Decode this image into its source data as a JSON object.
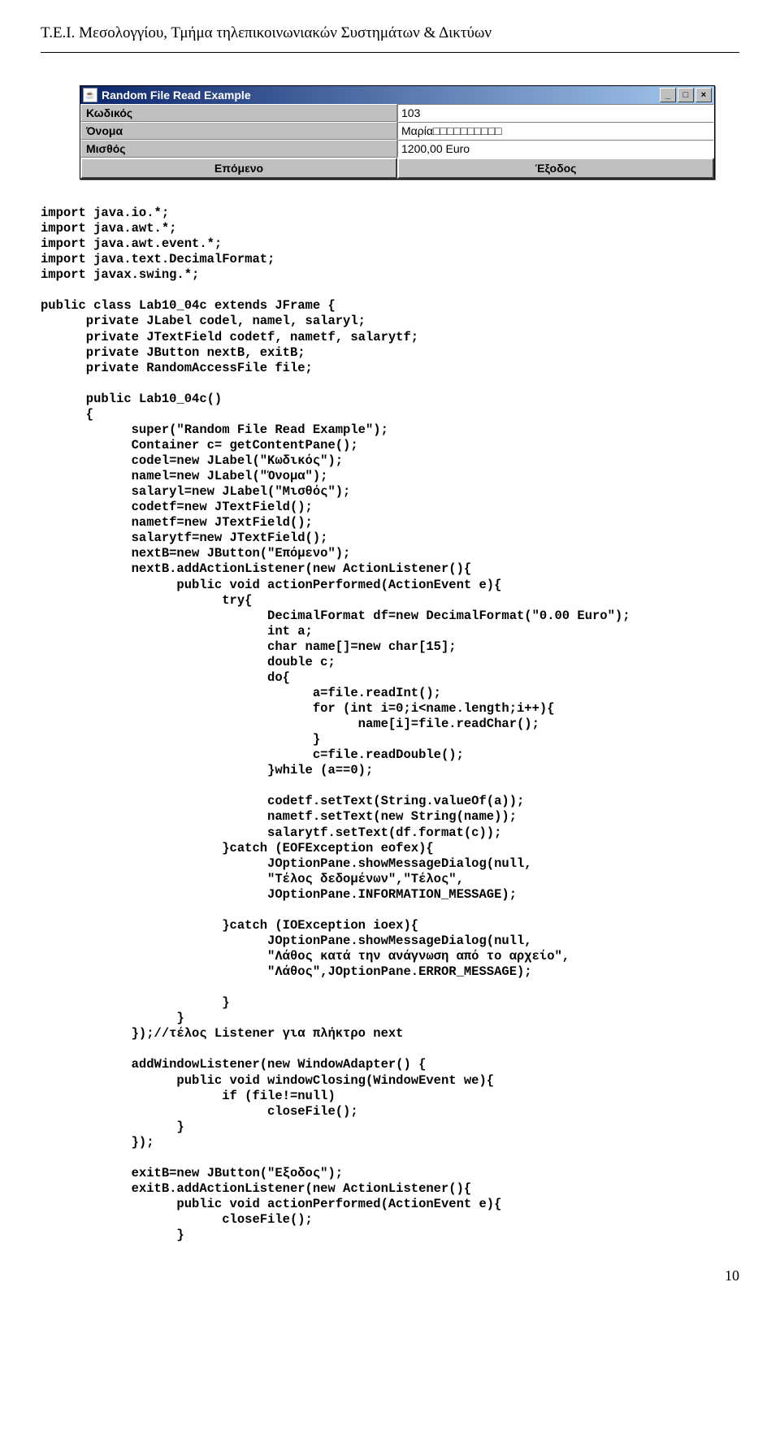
{
  "header": "Τ.Ε.Ι. Μεσολογγίου, Τμήμα τηλεπικοινωνιακών Συστημάτων & Δικτύων",
  "window": {
    "title": "Random File Read Example",
    "icon_alt": "☕",
    "min_symbol": "_",
    "max_symbol": "□",
    "close_symbol": "×",
    "rows": [
      {
        "label": "Κωδικός",
        "value": "103"
      },
      {
        "label": "Όνομα",
        "value": "Μαρία□□□□□□□□□□"
      },
      {
        "label": "Μισθός",
        "value": "1200,00 Euro"
      }
    ],
    "buttons": {
      "next": "Επόμενο",
      "exit": "Έξοδος"
    }
  },
  "code": "import java.io.*;\nimport java.awt.*;\nimport java.awt.event.*;\nimport java.text.DecimalFormat;\nimport javax.swing.*;\n\npublic class Lab10_04c extends JFrame {\n      private JLabel codel, namel, salaryl;\n      private JTextField codetf, nametf, salarytf;\n      private JButton nextB, exitB;\n      private RandomAccessFile file;\n\n      public Lab10_04c()\n      {\n            super(\"Random File Read Example\");\n            Container c= getContentPane();\n            codel=new JLabel(\"Κωδικός\");\n            namel=new JLabel(\"Όνομα\");\n            salaryl=new JLabel(\"Μισθός\");\n            codetf=new JTextField();\n            nametf=new JTextField();\n            salarytf=new JTextField();\n            nextB=new JButton(\"Επόμενο\");\n            nextB.addActionListener(new ActionListener(){\n                  public void actionPerformed(ActionEvent e){\n                        try{\n                              DecimalFormat df=new DecimalFormat(\"0.00 Euro\");\n                              int a;\n                              char name[]=new char[15];\n                              double c;\n                              do{\n                                    a=file.readInt();\n                                    for (int i=0;i<name.length;i++){\n                                          name[i]=file.readChar();\n                                    }\n                                    c=file.readDouble();\n                              }while (a==0);\n\n                              codetf.setText(String.valueOf(a));\n                              nametf.setText(new String(name));\n                              salarytf.setText(df.format(c));\n                        }catch (EOFException eofex){\n                              JOptionPane.showMessageDialog(null,\n                              \"Τέλος δεδομένων\",\"Τέλος\",\n                              JOptionPane.INFORMATION_MESSAGE);\n\n                        }catch (IOException ioex){\n                              JOptionPane.showMessageDialog(null,\n                              \"Λάθος κατά την ανάγνωση από το αρχείο\",\n                              \"Λάθος\",JOptionPane.ERROR_MESSAGE);\n\n                        }\n                  }\n            });//τέλος Listener για πλήκτρο next\n\n            addWindowListener(new WindowAdapter() {\n                  public void windowClosing(WindowEvent we){\n                        if (file!=null)\n                              closeFile();\n                  }\n            });\n\n            exitB=new JButton(\"Εξοδος\");\n            exitB.addActionListener(new ActionListener(){\n                  public void actionPerformed(ActionEvent e){\n                        closeFile();\n                  }",
  "page_number": "10"
}
